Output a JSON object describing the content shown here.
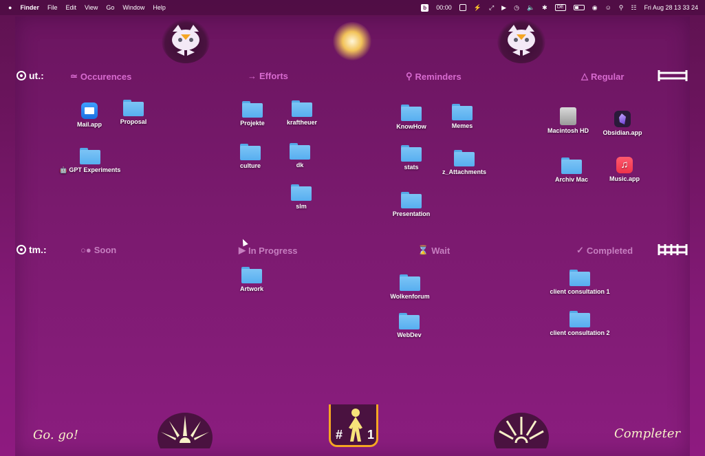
{
  "menubar": {
    "apple": "",
    "app": "Finder",
    "menus": [
      "File",
      "Edit",
      "View",
      "Go",
      "Window",
      "Help"
    ],
    "timer": "00:00",
    "keyboard": "DE",
    "clock": "Fri Aug 28  13 33 24"
  },
  "rows": {
    "top": {
      "label": "ut.:"
    },
    "bottom": {
      "label": "tm.:"
    }
  },
  "categories": {
    "occurences": "Occurences",
    "efforts": "Efforts",
    "reminders": "Reminders",
    "regular": "Regular",
    "soon": "Soon",
    "in_progress": "In Progress",
    "wait": "Wait",
    "completed": "Completed"
  },
  "items": {
    "mail": "Mail.app",
    "proposal": "Proposal",
    "gpt": "🤖 GPT Experiments",
    "projekte": "Projekte",
    "kraftheuer": "kraftheuer",
    "culture": "culture",
    "dk": "dk",
    "slm": "slm",
    "knowhow": "KnowHow",
    "memes": "Memes",
    "stats": "stats",
    "z_attachments": "z_Attachments",
    "presentation": "Presentation",
    "macintosh": "Macintosh HD",
    "obsidian": "Obsidian.app",
    "archiv": "Archiv Mac",
    "music": "Music.app",
    "artwork": "Artwork",
    "wolkenforum": "Wolkenforum",
    "webdev": "WebDev",
    "client1": "client consultation 1",
    "client2": "client consultation 2"
  },
  "footer": {
    "go": "Go. go!",
    "badge_left": "#",
    "badge_right": "1",
    "completer": "Completer"
  },
  "colors": {
    "background": "#7a1a6e",
    "category": "#d86bd0",
    "folder": "#57aef0",
    "script": "#f7f0c8"
  }
}
